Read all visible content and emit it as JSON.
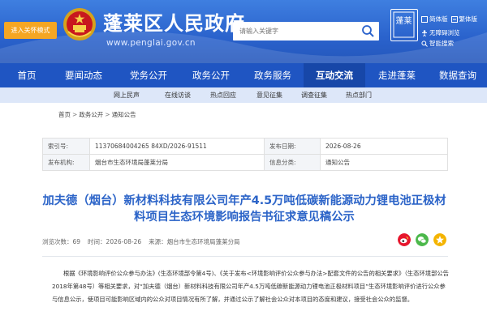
{
  "header": {
    "care_button": "进入关怀模式",
    "site_title": "蓬莱区人民政府",
    "site_url": "www.penglai.gov.cn",
    "search_placeholder": "请输入关键字",
    "seal_text": "蓬莱",
    "links_row1": [
      "简体版",
      "繁体版"
    ],
    "links_row2": [
      "无障碍浏览",
      "智能搜索"
    ]
  },
  "nav": {
    "items": [
      "首页",
      "要闻动态",
      "党务公开",
      "政务公开",
      "政务服务",
      "互动交流",
      "走进蓬莱",
      "数据查询"
    ],
    "active_index": 5
  },
  "subnav": {
    "items": [
      "网上民声",
      "在线访谈",
      "热点回应",
      "意见征集",
      "调查征集",
      "热点部门"
    ]
  },
  "breadcrumb": {
    "items": [
      "首页",
      "政务公开",
      "通知公告"
    ]
  },
  "info": {
    "index_label": "索引号:",
    "index_value": "11370684004265 84XD/2026-91511",
    "date_label": "发布日期:",
    "date_value": "2026-08-26",
    "org_label": "发布机构:",
    "org_value": "烟台市生态环境局蓬莱分局",
    "cat_label": "信息分类:",
    "cat_value": "通知公告"
  },
  "article": {
    "title_line1": "加夫德（烟台）新材料科技有限公司年产4.5万吨低碳新能源动力锂电池正极材",
    "title_line2": "料项目生态环境影响报告书征求意见稿公示",
    "views": "浏览次数：69",
    "time": "时间：2026-08-26",
    "source": "来源：烟台市生态环境局蓬莱分局",
    "body": "根据《环境影响评价公众参与办法》(生态环境部令第4号)、《关于发布<环境影响评价公众参与办法>配套文件的公告的相关要求》（生态环境部公告2018年第48号）等相关要求，对“加夫德（烟台）新材料科技有限公司年产4.5万吨低碳新能源动力锂电池正极材料项目”生态环境影响评价进行公众参与信息公示，使项目可能影响区域内的公众对项目情况有所了解，并通过公示了解社会公众对本项目的态度和建议，接受社会公众的监督。"
  },
  "colors": {
    "header_blue": "#2a62cc",
    "nav_blue": "#1f55c2",
    "nav_active": "#1747a8",
    "care_orange": "#f5a623",
    "title_blue": "#2c64c8",
    "weibo_red": "#e6162d",
    "wechat_green": "#4cb84b",
    "qzone_yellow": "#f4b400"
  },
  "icons": [
    "national-emblem-icon",
    "search-icon",
    "seal-icon",
    "simplified-icon",
    "traditional-icon",
    "accessibility-icon",
    "smart-search-icon",
    "weibo-icon",
    "wechat-icon",
    "qzone-icon"
  ]
}
